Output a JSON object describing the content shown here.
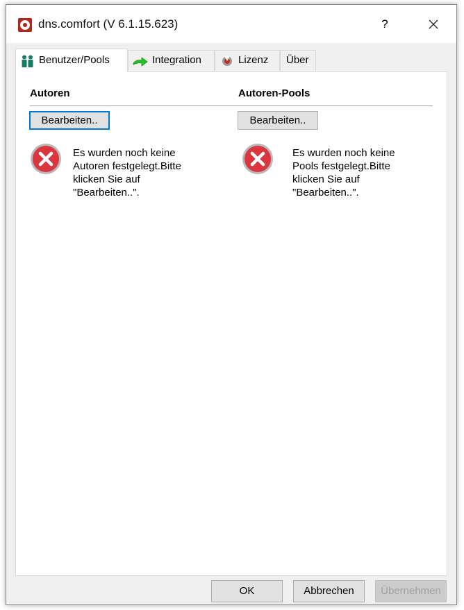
{
  "window": {
    "title": "dns.comfort (V 6.1.15.623)",
    "help_label": "?"
  },
  "tabs": [
    {
      "label": "Benutzer/Pools",
      "icon": "users-icon",
      "active": true
    },
    {
      "label": "Integration",
      "icon": "green-arrow-icon"
    },
    {
      "label": "Lizenz",
      "icon": "license-seal-icon"
    },
    {
      "label": "Über"
    }
  ],
  "left": {
    "heading": "Autoren",
    "button": "Bearbeiten..",
    "message_lines": [
      "Es wurden noch keine",
      "Autoren festgelegt.Bitte",
      "klicken Sie auf",
      "\"Bearbeiten..\"."
    ]
  },
  "right": {
    "heading": "Autoren-Pools",
    "button": "Bearbeiten..",
    "message_lines": [
      "Es wurden noch keine",
      "Pools festgelegt.Bitte",
      "klicken Sie auf",
      "\"Bearbeiten..\"."
    ]
  },
  "footer": {
    "ok": "OK",
    "cancel": "Abbrechen",
    "apply": "Übernehmen"
  },
  "colors": {
    "error_red": "#d9363e",
    "focus_blue": "#0078d7",
    "arrow_green": "#22c222"
  }
}
